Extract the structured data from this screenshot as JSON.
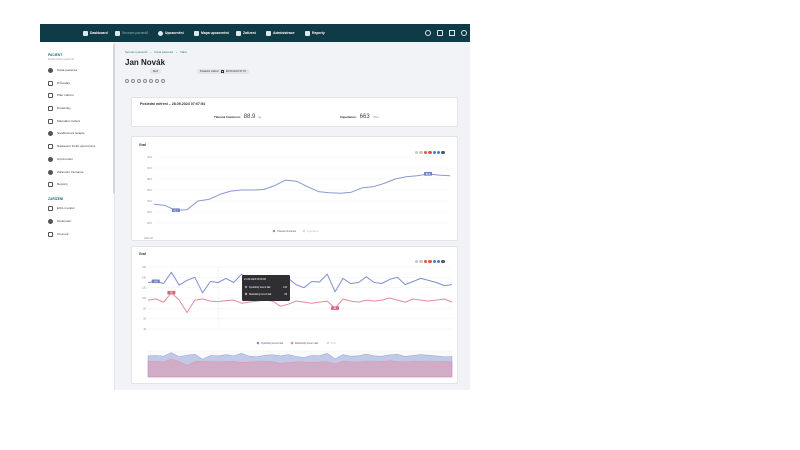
{
  "topbar": {
    "items": [
      {
        "label": "Dashboard",
        "icon": "chart-icon",
        "active": false
      },
      {
        "label": "Seznam pacientů",
        "icon": "user-icon",
        "active": true
      },
      {
        "label": "Upozornění",
        "icon": "bell-icon",
        "active": false
      },
      {
        "label": "Mapa upozornění",
        "icon": "map-icon",
        "active": false
      },
      {
        "label": "Zařízení",
        "icon": "device-icon",
        "active": false
      },
      {
        "label": "Administrace",
        "icon": "building-icon",
        "active": false
      },
      {
        "label": "Reporty",
        "icon": "report-icon",
        "active": false
      }
    ],
    "right_icons": [
      "settings-icon",
      "phone-icon",
      "fullscreen-icon",
      "account-icon"
    ]
  },
  "sidebar": {
    "patient_section": "PACIENT",
    "patient_sub": "Detail měření pacienta",
    "items": [
      {
        "label": "Karta pacienta",
        "icon": "user-icon"
      },
      {
        "label": "Průvodky",
        "icon": "document-icon"
      },
      {
        "label": "Plán měření",
        "icon": "calendar-icon"
      },
      {
        "label": "Dotazníky",
        "icon": "questionnaire-icon"
      },
      {
        "label": "Manuální měření",
        "icon": "edit-icon"
      },
      {
        "label": "Sandboxové terapie",
        "icon": "gear-icon"
      },
      {
        "label": "Nastavení limitů upozornění",
        "icon": "limit-icon"
      },
      {
        "label": "Upozornění",
        "icon": "bell-icon"
      },
      {
        "label": "Zdravotní zázname",
        "icon": "health-record-icon"
      },
      {
        "label": "Reporty",
        "icon": "report-icon"
      }
    ],
    "devices_section": "ZAŘÍZENÍ",
    "device_items": [
      {
        "label": "EKG monitor",
        "icon": "ekg-icon"
      },
      {
        "label": "Glukometr",
        "icon": "drop-icon"
      },
      {
        "label": "Oxymetr",
        "icon": "shield-icon"
      }
    ]
  },
  "breadcrumb": [
    "Seznam pacientů",
    "Karta pacienta",
    "Váha"
  ],
  "patient": {
    "name": "Jan Novák",
    "sex": "Muž",
    "last_measurement_label": "Poslední měření",
    "last_measurement_value": "28.09.2024 07:07"
  },
  "summary": {
    "title": "Poslední měření – 28.09.2024 07:07:54",
    "weight_label": "Tělesná hmotnost:",
    "weight_value": "88.9",
    "weight_unit": "kg",
    "impedance_label": "Impedance:",
    "impedance_value": "663",
    "impedance_unit": "Ohm"
  },
  "graph1": {
    "title": "Graf",
    "legend": [
      "Tělesná hmotnost",
      "Impedance"
    ],
    "toolbar_colors": [
      "#c9c9c9",
      "#c9c9c9",
      "#e0573b",
      "#e0573b",
      "#3b7ddd",
      "#3b7ddd",
      "#555555"
    ],
    "marker_label": "88.9",
    "marker_label_low": "82.3",
    "x_tick": "2024-08"
  },
  "graph2": {
    "title": "Graf",
    "tooltip_title": "21.09.2024 08:30:00",
    "tooltip_sys_label": "Systolický krevní tlak:",
    "tooltip_sys_value": "140",
    "tooltip_dia_label": "Diastolický krevní tlak:",
    "tooltip_dia_value": "86",
    "legend": [
      "Systolický krevní tlak",
      "Diastolický krevní tlak",
      "Puls"
    ],
    "toolbar_colors": [
      "#c9c9c9",
      "#c9c9c9",
      "#e0573b",
      "#e0573b",
      "#3b7ddd",
      "#3b7ddd",
      "#555555"
    ],
    "marker_sys": "140",
    "marker_dia": "96",
    "marker_sys2": "84"
  },
  "colors": {
    "topbar": "#0f3b46",
    "accent": "#1f8a70",
    "systolic": "#7f8fd0",
    "diastolic": "#e58aa0",
    "weight": "#8a99cf"
  },
  "chart_data": [
    {
      "type": "line",
      "title": "Graf",
      "ylim": [
        80,
        92
      ],
      "yticks": [
        "80.0",
        "82.0",
        "84.0",
        "86.0",
        "88.0",
        "90.0",
        "92.0"
      ],
      "series": [
        {
          "name": "Tělesná hmotnost",
          "values": [
            83.4,
            83.2,
            82.3,
            82.4,
            84.0,
            84.3,
            85.2,
            85.8,
            86.0,
            86.0,
            86.1,
            86.8,
            87.8,
            87.6,
            86.6,
            85.7,
            85.5,
            85.4,
            85.6,
            86.4,
            86.6,
            87.2,
            88.0,
            88.4,
            88.6,
            88.9,
            88.7,
            88.6
          ]
        }
      ],
      "grid": true,
      "legend_position": "bottom"
    },
    {
      "type": "line",
      "title": "Graf",
      "ylim": [
        40,
        160
      ],
      "yticks": [
        "40",
        "60",
        "80",
        "100",
        "120",
        "140",
        "160"
      ],
      "series": [
        {
          "name": "Systolický krevní tlak",
          "values": [
            130,
            132,
            128,
            150,
            125,
            134,
            140,
            110,
            132,
            130,
            138,
            130,
            146,
            128,
            124,
            134,
            137,
            130,
            138,
            126,
            120,
            132,
            131,
            146,
            112,
            138,
            128,
            130,
            141,
            130,
            128,
            136,
            140,
            126,
            132,
            138,
            134,
            130,
            124,
            126
          ]
        },
        {
          "name": "Diastolický krevní tlak",
          "values": [
            96,
            98,
            92,
            110,
            96,
            72,
            96,
            98,
            94,
            93,
            95,
            96,
            90,
            92,
            94,
            96,
            94,
            84,
            88,
            94,
            92,
            90,
            92,
            94,
            80,
            98,
            94,
            92,
            96,
            94,
            96,
            100,
            96,
            92,
            98,
            96,
            94,
            96,
            98,
            92
          ]
        }
      ],
      "grid": true,
      "legend_position": "bottom"
    }
  ]
}
